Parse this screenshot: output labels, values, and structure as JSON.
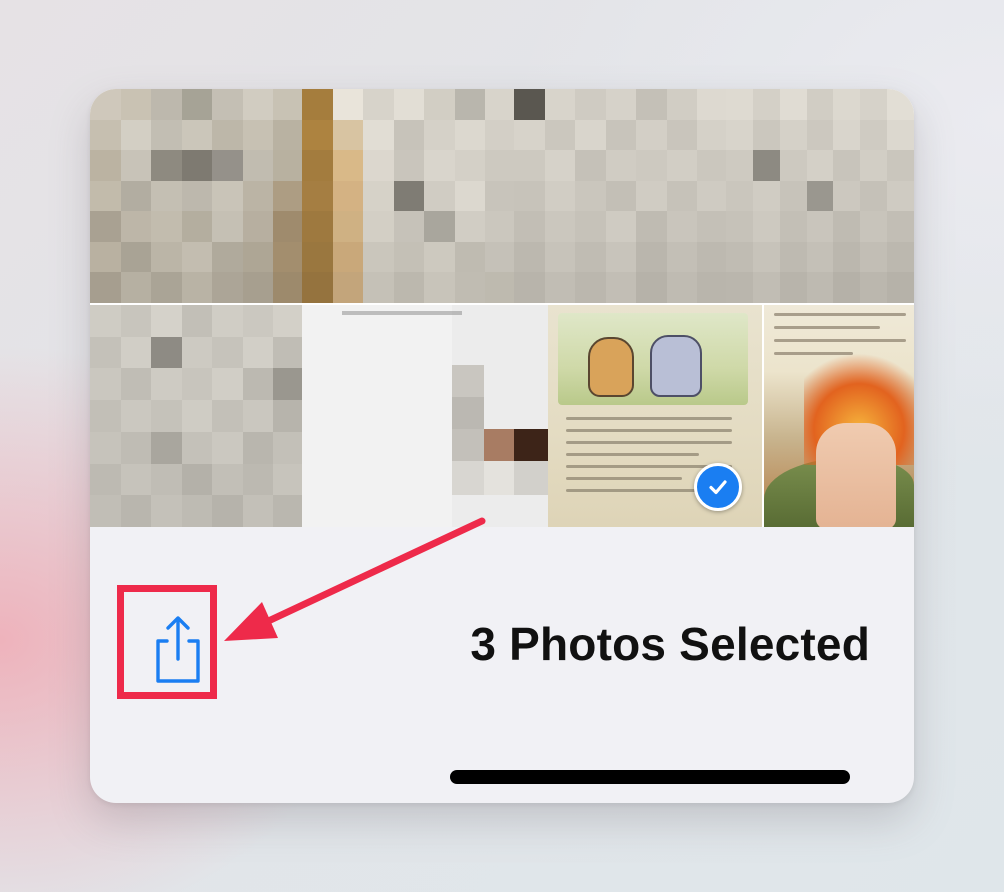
{
  "toolbar": {
    "title": "3 Photos Selected",
    "share_icon": "share-icon"
  },
  "photos": [
    {
      "kind": "blurred",
      "selected": false
    },
    {
      "kind": "blurred",
      "selected": false
    },
    {
      "kind": "blurred",
      "selected": false
    },
    {
      "kind": "blurred",
      "selected": false
    },
    {
      "kind": "blurred",
      "selected": false
    },
    {
      "kind": "blurred",
      "selected": false
    },
    {
      "kind": "book-page",
      "selected": true
    },
    {
      "kind": "book-page",
      "selected": false
    }
  ],
  "colors": {
    "accent": "#1a7ef2",
    "annotation": "#ee2a4a",
    "toolbar_bg": "#f1f1f5"
  }
}
